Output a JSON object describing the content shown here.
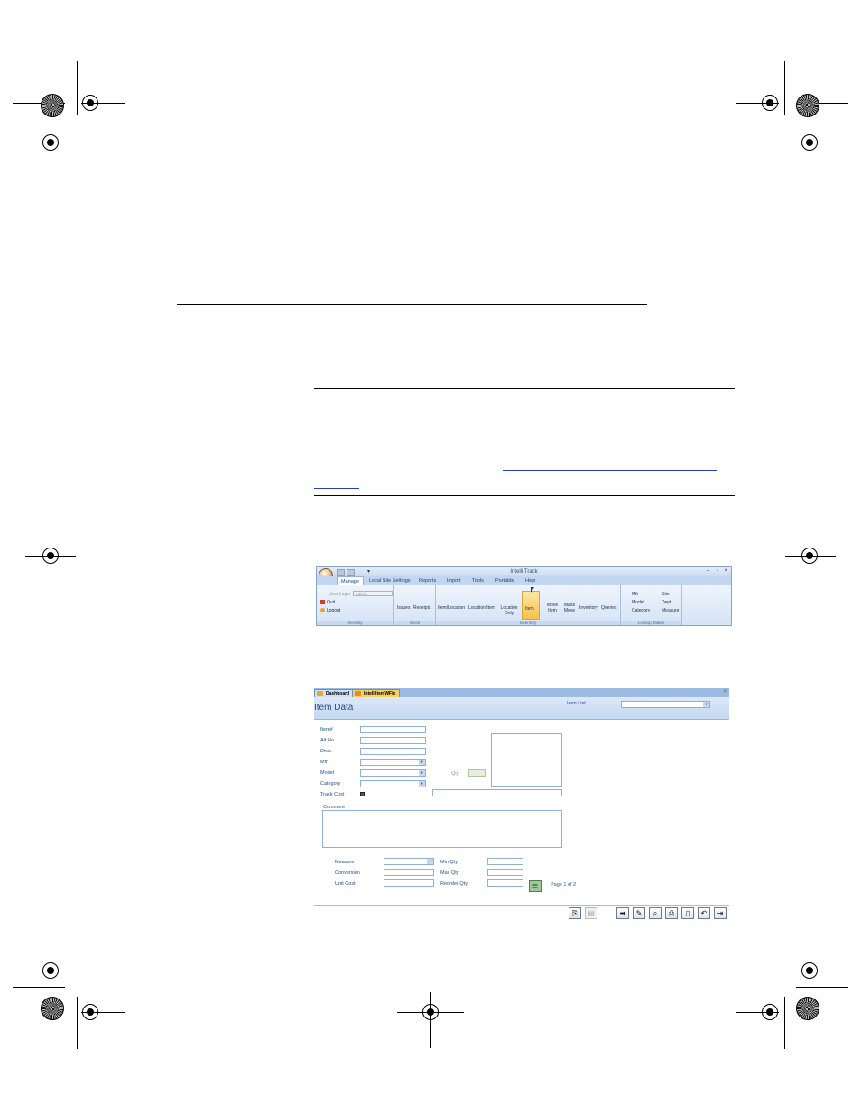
{
  "ribbon": {
    "app_title": "Intelli Track",
    "window_controls": {
      "minimize": "–",
      "restore": "▫",
      "close": "×"
    },
    "qat_more": "▾",
    "tabs": [
      "Manage",
      "Local Site Settings",
      "Reports",
      "Import",
      "Tools",
      "Portable",
      "Help"
    ],
    "active_tab": "Manage",
    "security": {
      "user_login_label": "User Login",
      "user_login_value": "Admin",
      "quit": "Quit",
      "logout": "Logout",
      "group_label": "Security"
    },
    "stock": {
      "items": [
        "Issues",
        "Receipts"
      ],
      "group_label": "Stock"
    },
    "inventory": {
      "items": [
        "Item/Location",
        "Location/Item",
        "Location Only",
        "Item",
        "Move Item",
        "Mass Move",
        "Inventory",
        "Queries"
      ],
      "group_label": "Inventory"
    },
    "lookup": {
      "items": [
        "Mfr",
        "Site",
        "Model",
        "Dept",
        "Category",
        "Measure"
      ],
      "group_label": "Lookup Tables"
    }
  },
  "form": {
    "tabs": [
      "Dashboard",
      "IntelliItemWFlx"
    ],
    "active_tab": "IntelliItemWFlx",
    "close": "×",
    "title": "Item Data",
    "item_list_label": "Item List",
    "fields": {
      "item_no": "Item#",
      "alt_no": "Alt No",
      "desc": "Desc",
      "mfr": "Mfr",
      "model": "Model",
      "category": "Category",
      "track_cost": "Track Cost",
      "qty": "Qty",
      "comment": "Comment",
      "measure": "Measure",
      "conversion": "Conversion",
      "unit_cost": "Unit Cost",
      "min_qty": "Min Qty",
      "max_qty": "Max Qty",
      "reorder_qty": "Reorder Qty"
    },
    "pager": "Page 1 of 2"
  },
  "colors": {
    "ribbon_bg": "#dce8f7",
    "tab_bar": "#9bbbe3",
    "label_blue": "#1f4f8f",
    "item_highlight": "#f8c14a",
    "tab_active": "#f7d060"
  }
}
